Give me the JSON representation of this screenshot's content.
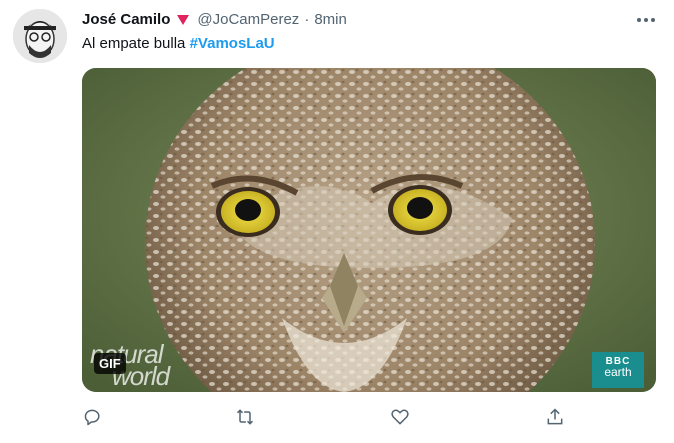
{
  "author": {
    "display_name": "José Camilo",
    "badge_icon": "red-triangle-icon",
    "badge_color": "#e0245e",
    "handle": "@JoCamPerez",
    "separator": "·",
    "timestamp": "8min"
  },
  "tweet": {
    "text": "Al empate bulla ",
    "hashtag": "#VamosLaU",
    "hashtag_color": "#1d9bf0"
  },
  "media": {
    "type": "gif",
    "badge": "GIF",
    "watermark_left": [
      "natural",
      "world"
    ],
    "watermark_right": [
      "BBC",
      "earth"
    ],
    "subject": "burrowing owl close-up"
  },
  "actions": [
    {
      "icon": "reply-icon"
    },
    {
      "icon": "retweet-icon"
    },
    {
      "icon": "like-icon"
    },
    {
      "icon": "share-icon"
    }
  ],
  "menu_icon": "more-icon"
}
